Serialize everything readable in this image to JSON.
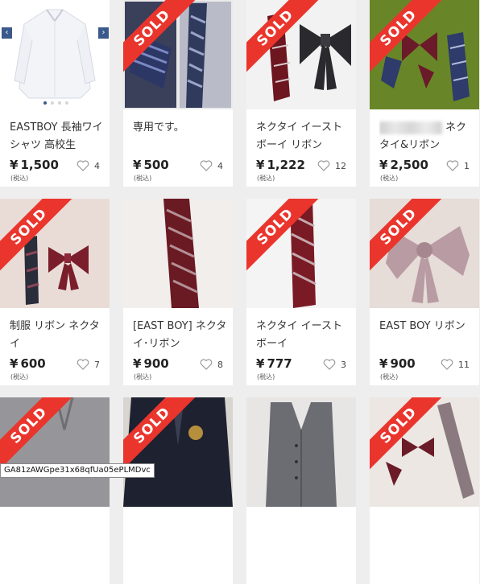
{
  "colors": {
    "sold_ribbon": "#ea352d",
    "background": "#eeeeee",
    "accent": "#3b5a8c"
  },
  "sold_label": "SOLD",
  "tax_label": "(税込)",
  "currency": "¥",
  "items": [
    {
      "title": "EASTBOY 長袖ワイシャツ 高校生",
      "price": "1,500",
      "likes": "4",
      "sold": false
    },
    {
      "title": "専用です。",
      "price": "500",
      "likes": "4",
      "sold": true
    },
    {
      "title": "ネクタイ イーストボーイ リボン",
      "price": "1,222",
      "likes": "12",
      "sold": true
    },
    {
      "title": "ネクタイ&リボン",
      "price": "2,500",
      "likes": "1",
      "sold": true
    },
    {
      "title": "制服 リボン ネクタイ",
      "price": "600",
      "likes": "7",
      "sold": true
    },
    {
      "title": "[EAST BOY] ネクタイ･リボン",
      "price": "900",
      "likes": "8",
      "sold": false
    },
    {
      "title": "ネクタイ イーストボーイ",
      "price": "777",
      "likes": "3",
      "sold": true
    },
    {
      "title": "EAST BOY リボン",
      "price": "900",
      "likes": "11",
      "sold": true
    },
    {
      "title": "",
      "price": "",
      "likes": "",
      "sold": true
    },
    {
      "title": "",
      "price": "",
      "likes": "",
      "sold": true
    },
    {
      "title": "",
      "price": "",
      "likes": "",
      "sold": false
    },
    {
      "title": "",
      "price": "",
      "likes": "",
      "sold": true
    }
  ],
  "carousel": {
    "prev": "‹",
    "next": "›"
  },
  "status_tooltip": "GA81zAWGpe31x68qfUa05ePLMDvc"
}
